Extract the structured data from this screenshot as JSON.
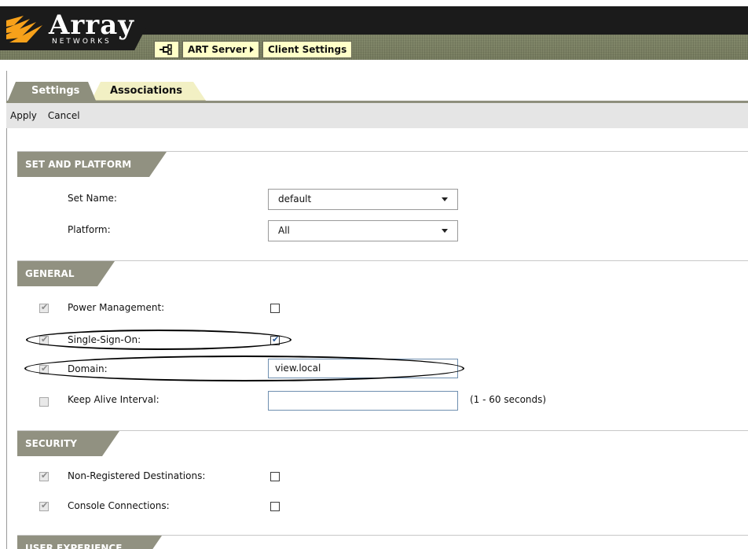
{
  "brand": {
    "name": "Array",
    "subtitle": "NETWORKS"
  },
  "breadcrumb": {
    "icon": "network-icon",
    "items": [
      "ART Server",
      "Client Settings"
    ]
  },
  "tabs": [
    {
      "label": "Settings",
      "active": true
    },
    {
      "label": "Associations",
      "active": false
    }
  ],
  "actions": {
    "apply": "Apply",
    "cancel": "Cancel"
  },
  "sections": {
    "set_platform": {
      "title": "SET AND PLATFORM",
      "set_name_label": "Set Name:",
      "set_name_value": "default",
      "platform_label": "Platform:",
      "platform_value": "All"
    },
    "general": {
      "title": "GENERAL",
      "power_management_label": "Power Management:",
      "single_sign_on_label": "Single-Sign-On:",
      "domain_label": "Domain:",
      "domain_value": "view.local",
      "keep_alive_label": "Keep Alive Interval:",
      "keep_alive_value": "",
      "keep_alive_hint": "(1 - 60 seconds)"
    },
    "security": {
      "title": "SECURITY",
      "non_registered_label": "Non-Registered Destinations:",
      "console_connections_label": "Console Connections:"
    },
    "user_experience": {
      "title": "USER EXPERIENCE"
    }
  },
  "states": {
    "power_management_enable": true,
    "power_management_value": false,
    "single_sign_on_enable": true,
    "single_sign_on_value": true,
    "domain_enable": true,
    "keep_alive_enable": false,
    "non_registered_enable": true,
    "non_registered_value": false,
    "console_connections_enable": true,
    "console_connections_value": false
  },
  "colors": {
    "accent": "#f7a11a",
    "section_bg": "#919181",
    "tab_active_bg": "#8e8f7d",
    "tab_inactive_bg": "#f2f0c4",
    "crumb_bg": "#ffffc8"
  }
}
